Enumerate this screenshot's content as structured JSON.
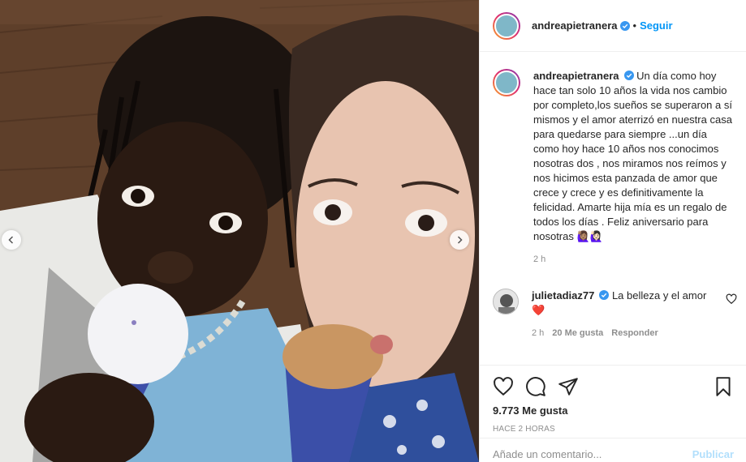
{
  "post": {
    "username": "andreapietranera",
    "verified": true,
    "follow_label": "Seguir",
    "separator": "•"
  },
  "caption": {
    "username": "andreapietranera",
    "text": "Un día como hoy hace tan solo 10 años la vida nos cambio por completo,los sueños se superaron a sí mismos y el amor aterrizó en nuestra casa para quedarse para siempre ...un día como hoy hace 10 años nos conocimos nosotras dos , nos miramos nos reímos y nos hicimos esta panzada de amor que crece y crece y es definitivamente la felicidad. Amarte hija mía es un regalo de todos los días . Feliz aniversario para nosotras",
    "emoji": "🙋🏽‍♀️🙋🏻‍♀️",
    "time": "2 h"
  },
  "comments": [
    {
      "username": "julietadiaz77",
      "verified": true,
      "text": "La belleza y el amor",
      "emoji": "❤️",
      "time": "2 h",
      "likes": "20 Me gusta",
      "reply_label": "Responder"
    }
  ],
  "actions": {
    "likes": "9.773 Me gusta",
    "time_ago": "HACE 2 HORAS"
  },
  "add_comment": {
    "placeholder": "Añade un comentario...",
    "publish_label": "Publicar"
  },
  "icons": [
    "heart-icon",
    "comment-icon",
    "share-icon",
    "bookmark-icon",
    "chevron-left-icon",
    "chevron-right-icon",
    "verified-icon"
  ],
  "colors": {
    "accent": "#0095f6",
    "heart": "#ed4956",
    "publish_disabled": "#b2dffc",
    "muted": "#8e8e8e"
  }
}
